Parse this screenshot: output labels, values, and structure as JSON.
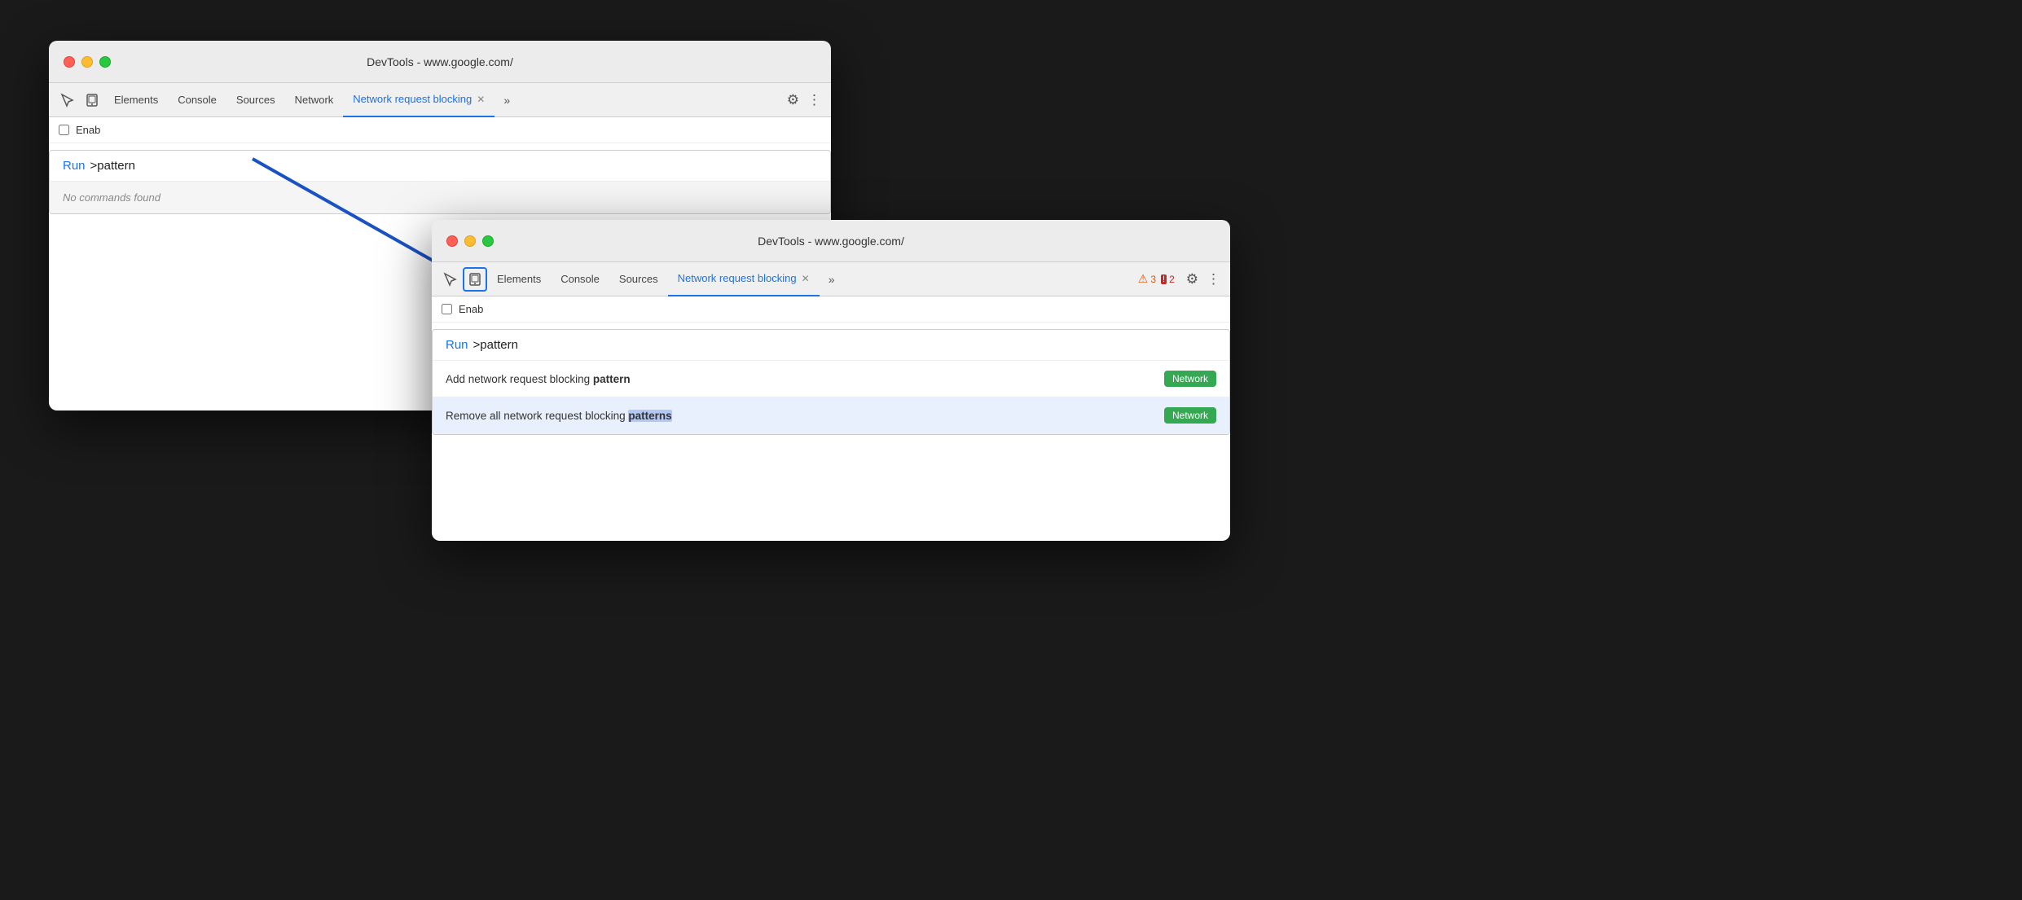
{
  "window1": {
    "title": "DevTools - www.google.com/",
    "tabs": [
      {
        "label": "Elements",
        "active": false
      },
      {
        "label": "Console",
        "active": false
      },
      {
        "label": "Sources",
        "active": false
      },
      {
        "label": "Network",
        "active": false
      },
      {
        "label": "Network request blocking",
        "active": true
      }
    ],
    "enable_label": "Enab",
    "command": {
      "run_label": "Run",
      "input_text": ">pattern",
      "empty_message": "No commands found"
    }
  },
  "window2": {
    "title": "DevTools - www.google.com/",
    "tabs": [
      {
        "label": "Elements",
        "active": false
      },
      {
        "label": "Console",
        "active": false
      },
      {
        "label": "Sources",
        "active": false
      },
      {
        "label": "Network request blocking",
        "active": true
      }
    ],
    "badges": {
      "warning_count": "3",
      "error_count": "2"
    },
    "enable_label": "Enab",
    "command": {
      "run_label": "Run",
      "input_text": ">pattern",
      "results": [
        {
          "id": "add-blocking",
          "text_before": "Add network request blocking ",
          "text_bold": "pattern",
          "text_after": "",
          "badge": "Network",
          "selected": false
        },
        {
          "id": "remove-blocking",
          "text_before": "Remove all network request blocking ",
          "text_bold": "patterns",
          "text_after": "s",
          "badge": "Network",
          "selected": true
        }
      ]
    }
  },
  "icons": {
    "inspect": "⬚",
    "device": "☐",
    "chevron_right": "»",
    "gear": "⚙",
    "more": "⋮",
    "warning": "⚠",
    "error": "⛔"
  },
  "colors": {
    "active_tab": "#1a73e8",
    "network_badge": "#34a853",
    "warning": "#e65100",
    "error": "#c62828"
  }
}
